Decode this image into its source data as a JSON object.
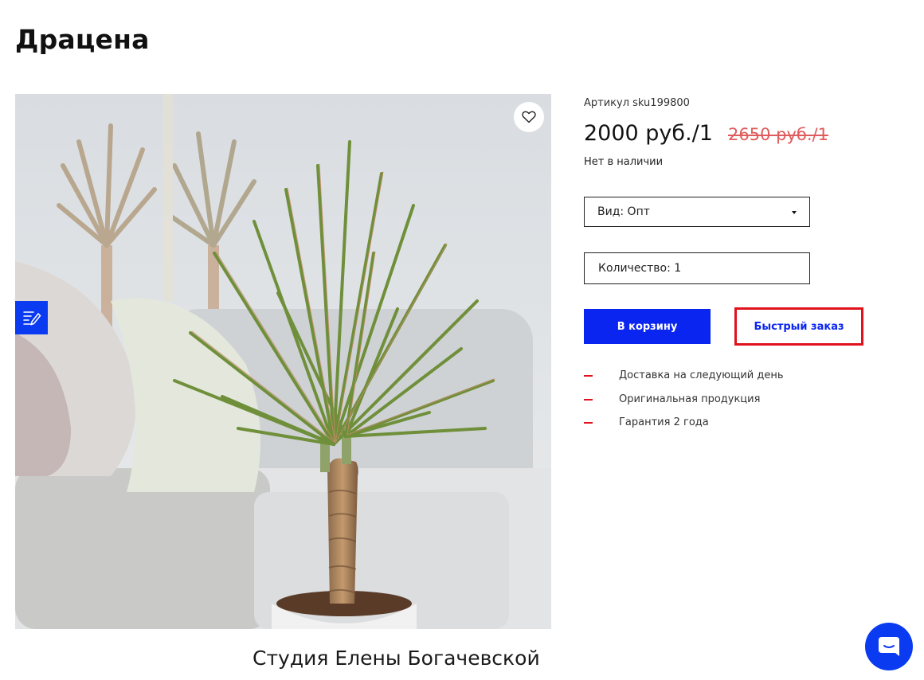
{
  "product": {
    "title": "Драцена",
    "sku_label": "Артикул sku199800",
    "price": "2000 руб./1",
    "old_price": "2650 руб./1",
    "stock_status": "Нет в наличии"
  },
  "options": {
    "variant_label": "Вид: Опт",
    "quantity_label": "Количество: 1"
  },
  "actions": {
    "add_to_cart": "В корзину",
    "quick_order": "Быстрый заказ"
  },
  "features": [
    "Доставка на следующий день",
    "Оригинальная продукция",
    "Гарантия 2 года"
  ],
  "gallery": {
    "caption": "Студия Елены Богачевской",
    "favorite_icon": "heart-icon",
    "edit_icon": "edit-note-icon"
  },
  "widgets": {
    "chat_icon": "chat-icon"
  },
  "colors": {
    "accent_blue": "#0a25f0",
    "highlight_red": "#e0121b",
    "old_price_red": "#e05c5c"
  }
}
